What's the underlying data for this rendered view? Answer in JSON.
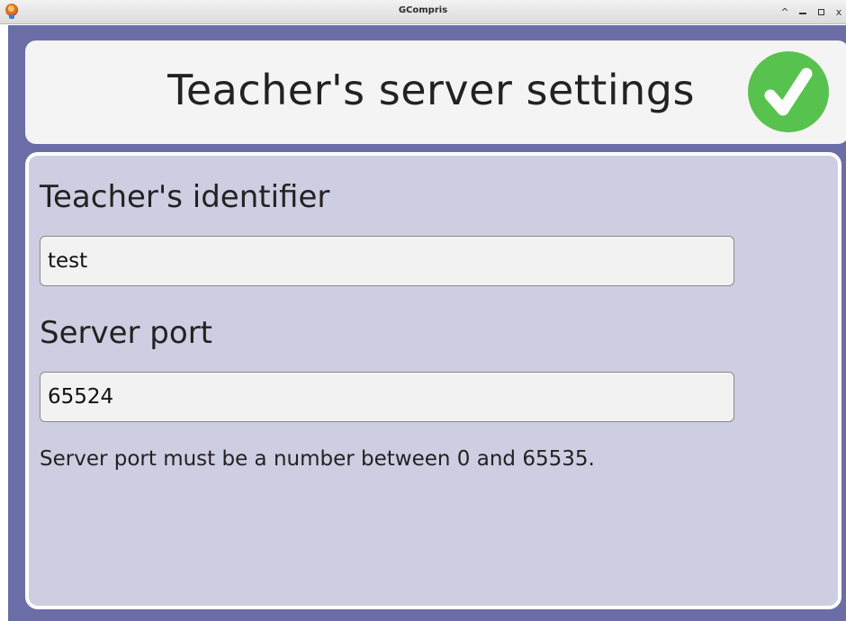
{
  "window": {
    "title": "GCompris",
    "controls": {
      "shade_glyph": "^",
      "minimize_label": "minimize",
      "maximize_label": "maximize",
      "close_glyph": "x"
    }
  },
  "colors": {
    "app_background": "#6b6ea6",
    "panel_background": "#cdcee1",
    "header_background": "#f4f4f4",
    "ok_green": "#58c24f"
  },
  "header": {
    "title": "Teacher's server settings",
    "ok_icon": "checkmark-icon"
  },
  "form": {
    "teacher_id_label": "Teacher's identifier",
    "teacher_id_value": "test",
    "server_port_label": "Server port",
    "server_port_value": "65524",
    "port_hint": "Server port must be a number between 0 and 65535."
  }
}
